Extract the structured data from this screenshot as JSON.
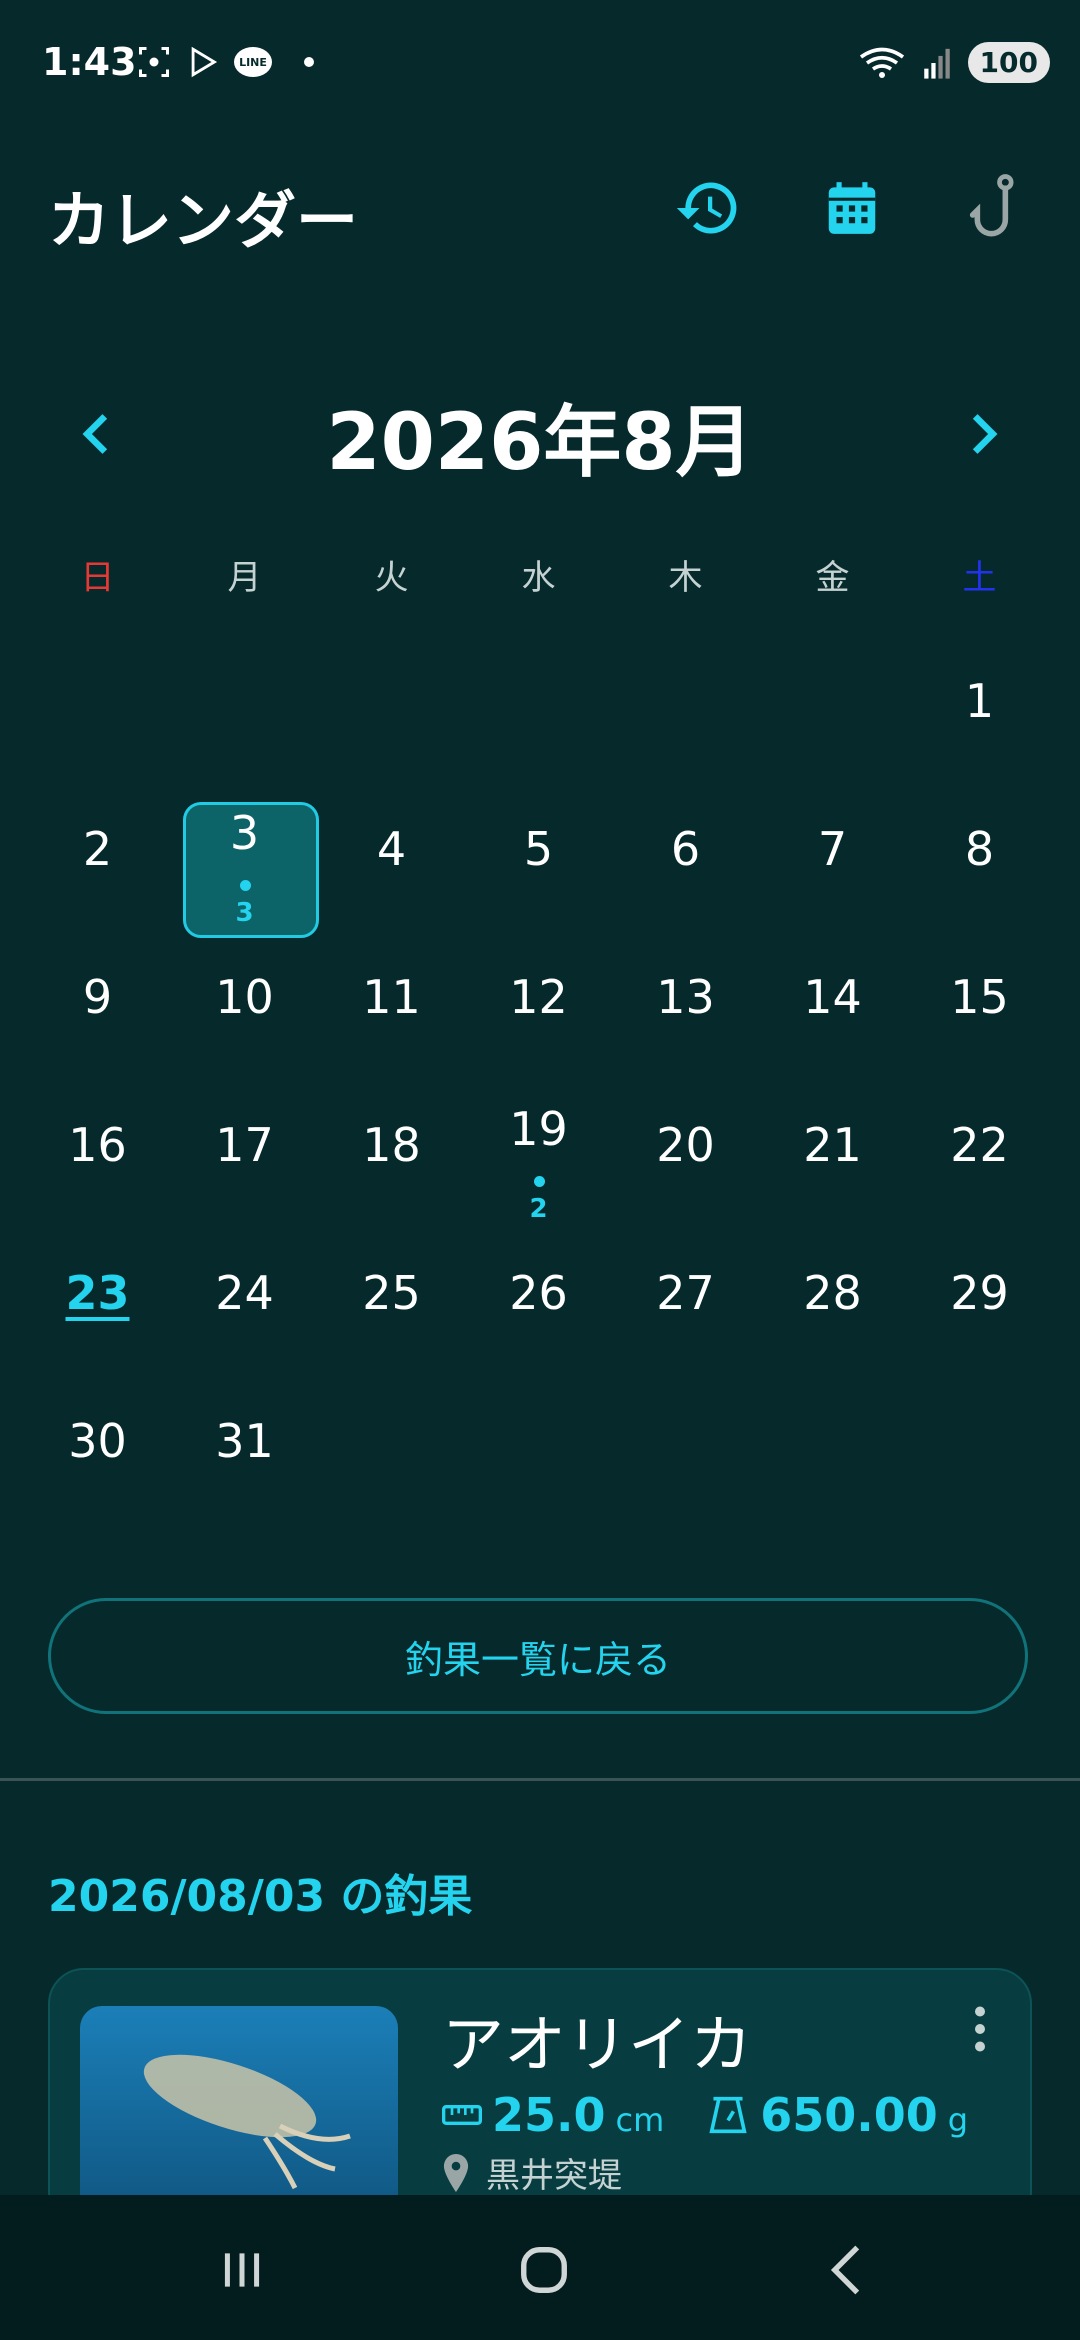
{
  "status": {
    "time": "1:43",
    "battery": "100",
    "line_badge": "LINE",
    "wifi_label": "5"
  },
  "app_bar": {
    "title": "カレンダー",
    "icons": [
      "history-icon",
      "calendar-icon",
      "fishhook-icon"
    ]
  },
  "calendar": {
    "month_title": "2026年8月",
    "weekdays": [
      "日",
      "月",
      "火",
      "水",
      "木",
      "金",
      "土"
    ],
    "weekday_colors": [
      "#e53935",
      "#c5d2d2",
      "#c5d2d2",
      "#c5d2d2",
      "#c5d2d2",
      "#c5d2d2",
      "#2233ee"
    ],
    "days": [
      {
        "n": "1"
      },
      {
        "n": "2"
      },
      {
        "n": "3",
        "count": "3",
        "selected": true
      },
      {
        "n": "4"
      },
      {
        "n": "5"
      },
      {
        "n": "6"
      },
      {
        "n": "7"
      },
      {
        "n": "8"
      },
      {
        "n": "9"
      },
      {
        "n": "10"
      },
      {
        "n": "11"
      },
      {
        "n": "12"
      },
      {
        "n": "13"
      },
      {
        "n": "14"
      },
      {
        "n": "15"
      },
      {
        "n": "16"
      },
      {
        "n": "17"
      },
      {
        "n": "18"
      },
      {
        "n": "19",
        "count": "2"
      },
      {
        "n": "20"
      },
      {
        "n": "21"
      },
      {
        "n": "22"
      },
      {
        "n": "23",
        "today": true
      },
      {
        "n": "24"
      },
      {
        "n": "25"
      },
      {
        "n": "26"
      },
      {
        "n": "27"
      },
      {
        "n": "28"
      },
      {
        "n": "29"
      },
      {
        "n": "30"
      },
      {
        "n": "31"
      }
    ]
  },
  "back_button": "釣果一覧に戻る",
  "selected_section": {
    "title": "2026/08/03 の釣果",
    "catch": {
      "name": "アオリイカ",
      "length": "25.0",
      "length_unit": "cm",
      "weight": "650.00",
      "weight_unit": "g",
      "location": "黒井突堤"
    }
  },
  "colors": {
    "background": "#06292b",
    "accent": "#24d3ee",
    "card": "#073d40",
    "selected_cell": "#0c6468"
  }
}
